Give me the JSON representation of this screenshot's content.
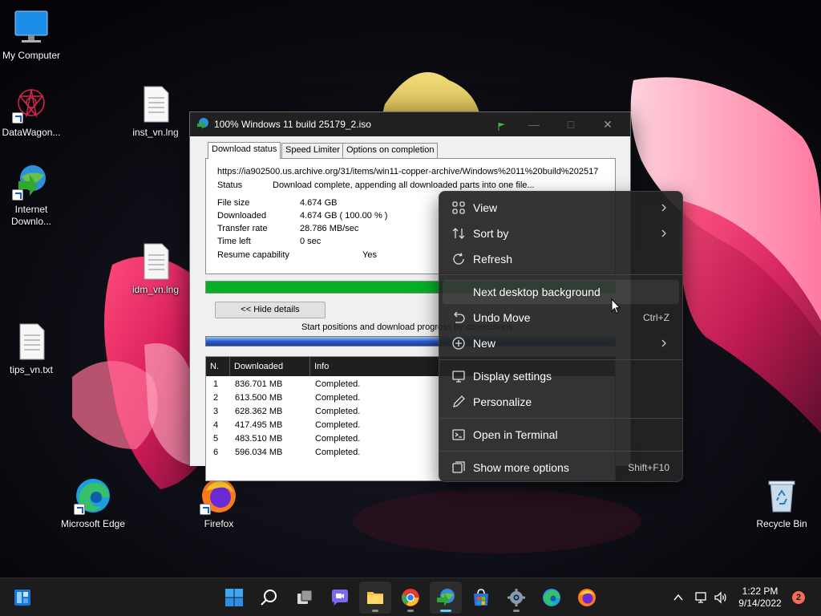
{
  "desktop": {
    "icons": [
      {
        "label": "My Computer"
      },
      {
        "label": "DataWagon..."
      },
      {
        "label": "Internet Downlo..."
      },
      {
        "label": "tips_vn.txt"
      },
      {
        "label": "inst_vn.lng"
      },
      {
        "label": "idm_vn.lng"
      },
      {
        "label": "Microsoft Edge"
      },
      {
        "label": "Firefox"
      },
      {
        "label": "Recycle Bin"
      }
    ]
  },
  "idm": {
    "title": "100% Windows 11 build 25179_2.iso",
    "tabs": [
      "Download status",
      "Speed Limiter",
      "Options on completion"
    ],
    "url": "https://ia902500.us.archive.org/31/items/win11-copper-archive/Windows%2011%20build%202517",
    "status_label": "Status",
    "status_value": "Download complete, appending all downloaded parts into one file...",
    "file_size_label": "File size",
    "file_size_value": "4.674  GB",
    "downloaded_label": "Downloaded",
    "downloaded_value": "4.674  GB  ( 100.00 % )",
    "transfer_rate_label": "Transfer rate",
    "transfer_rate_value": "28.786  MB/sec",
    "time_left_label": "Time left",
    "time_left_value": "0 sec",
    "resume_label": "Resume capability",
    "resume_value": "Yes",
    "progress_fraction": 1.0,
    "hide_details_label": "<< Hide details",
    "start_positions_label": "Start positions and download progress by connections",
    "table": {
      "headers": [
        "N.",
        "Downloaded",
        "Info"
      ],
      "rows": [
        {
          "n": "1",
          "downloaded": "836.701  MB",
          "info": "Completed."
        },
        {
          "n": "2",
          "downloaded": "613.500  MB",
          "info": "Completed."
        },
        {
          "n": "3",
          "downloaded": "628.362  MB",
          "info": "Completed."
        },
        {
          "n": "4",
          "downloaded": "417.495  MB",
          "info": "Completed."
        },
        {
          "n": "5",
          "downloaded": "483.510  MB",
          "info": "Completed."
        },
        {
          "n": "6",
          "downloaded": "596.034  MB",
          "info": "Completed."
        }
      ]
    }
  },
  "context_menu": {
    "items": [
      {
        "label": "View",
        "icon": "grid-icon",
        "submenu": true
      },
      {
        "label": "Sort by",
        "icon": "sort-icon",
        "submenu": true
      },
      {
        "label": "Refresh",
        "icon": "refresh-icon"
      },
      {
        "label": "Next desktop background",
        "icon": ""
      },
      {
        "label": "Undo Move",
        "icon": "undo-icon",
        "shortcut": "Ctrl+Z"
      },
      {
        "label": "New",
        "icon": "plus-circle-icon",
        "submenu": true
      },
      {
        "label": "Display settings",
        "icon": "display-icon"
      },
      {
        "label": "Personalize",
        "icon": "pen-icon"
      },
      {
        "label": "Open in Terminal",
        "icon": "terminal-icon"
      },
      {
        "label": "Show more options",
        "icon": "more-options-icon",
        "shortcut": "Shift+F10"
      }
    ]
  },
  "taskbar": {
    "time": "1:22 PM",
    "date": "9/14/2022",
    "notification_count": "2"
  },
  "colors": {
    "progress_green": "#06b025",
    "accent_blue": "#60cdff",
    "menu_bg": "#242424",
    "taskbar_bg": "#1c1c1c"
  }
}
